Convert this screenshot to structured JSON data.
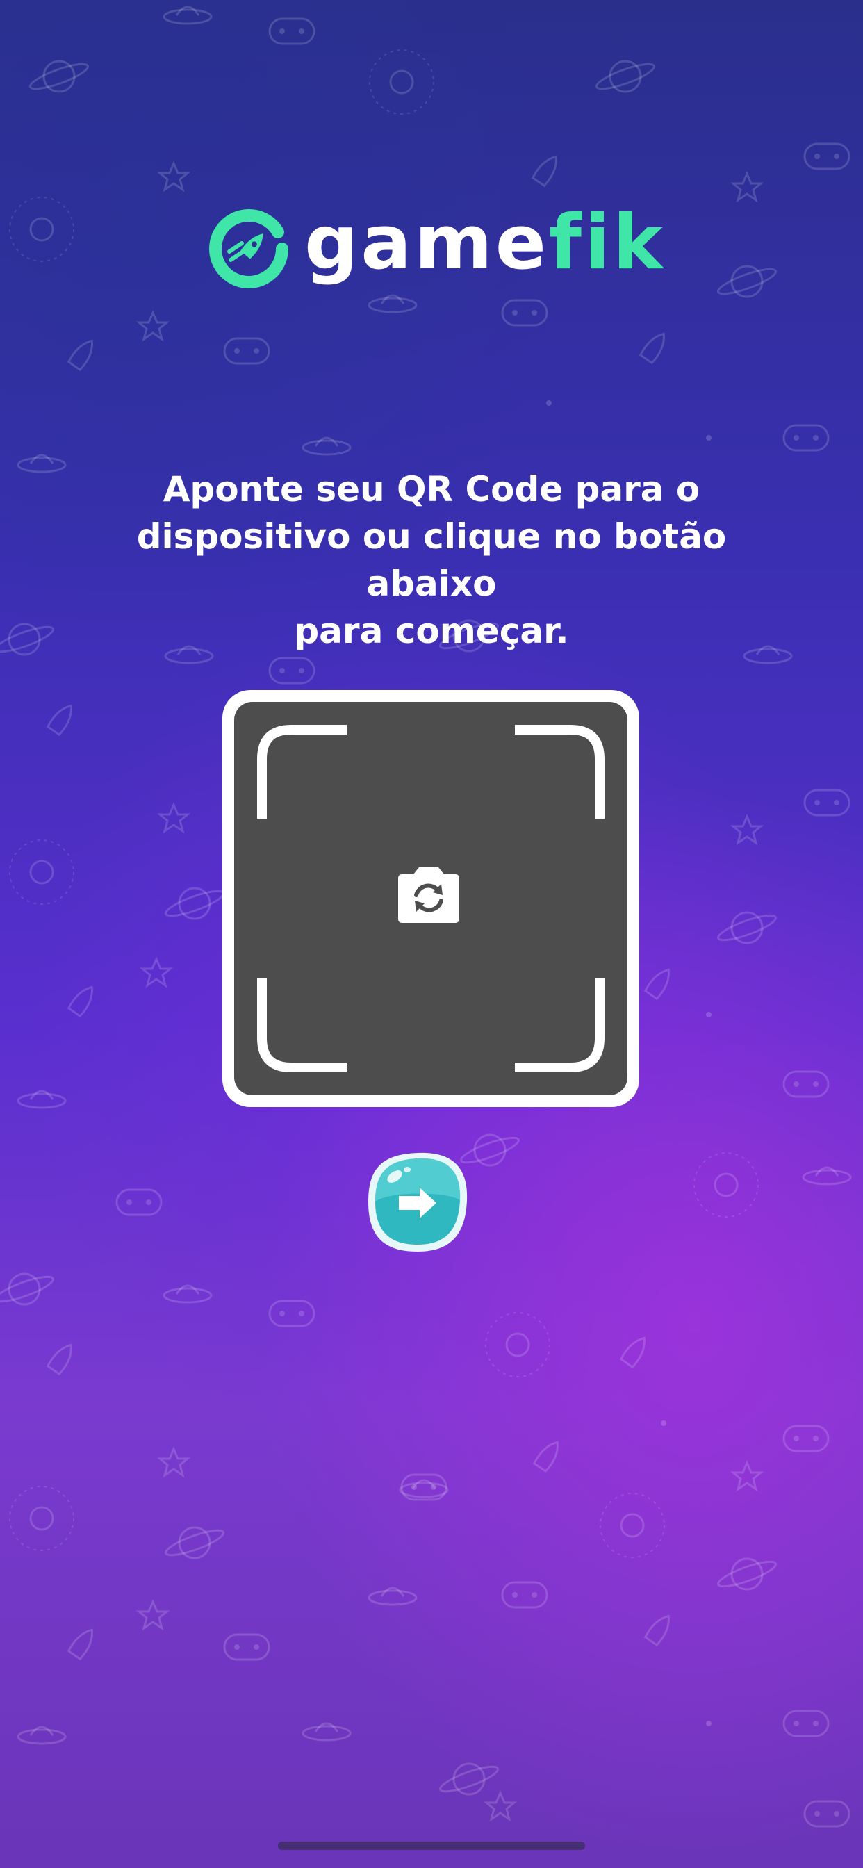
{
  "app": {
    "brand": "gamefik",
    "brand_part_white": "game",
    "brand_part_green": "fik"
  },
  "instruction": {
    "line1": "Aponte seu QR Code para o",
    "line2": "dispositivo ou clique no botão abaixo",
    "line3": "para começar."
  },
  "scanner": {
    "center_icon": "camera-switch-icon"
  },
  "actions": {
    "next_icon": "arrow-right-icon"
  },
  "colors": {
    "brand_green": "#3fe6a8",
    "button_teal": "#2fb8c0",
    "scanner_bg": "#4d4d4d"
  }
}
